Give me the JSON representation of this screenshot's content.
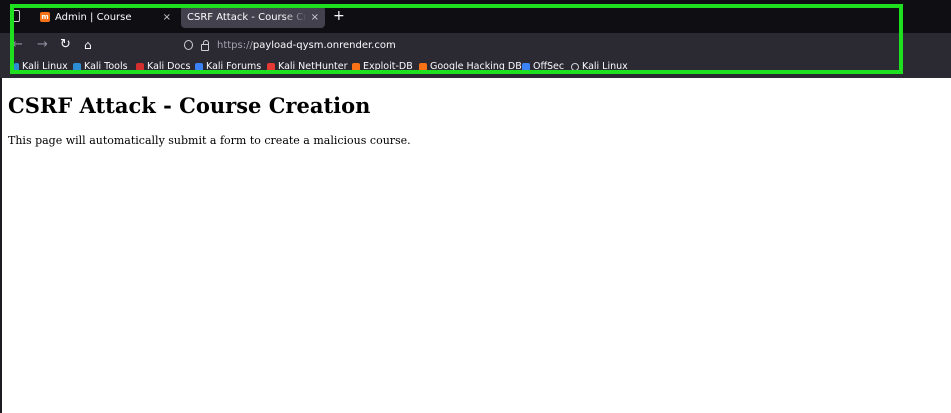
{
  "browser": {
    "tabs": [
      {
        "label": "Admin | Course",
        "active": false
      },
      {
        "label": "CSRF Attack - Course Creation",
        "active": true
      }
    ],
    "new_tab": "+",
    "close_glyph": "×",
    "url_protocol": "https://",
    "url_host": "payload-qysm.onrender.com",
    "bookmarks": [
      {
        "label": "Kali Linux",
        "icon": "kali-icon",
        "color": "#2c8fd6"
      },
      {
        "label": "Kali Tools",
        "icon": "kali-tools-icon",
        "color": "#2c8fd6"
      },
      {
        "label": "Kali Docs",
        "icon": "kali-docs-icon",
        "color": "#d32f2f"
      },
      {
        "label": "Kali Forums",
        "icon": "kali-forums-icon",
        "color": "#3b82f6"
      },
      {
        "label": "Kali NetHunter",
        "icon": "nethunter-icon",
        "color": "#e53935"
      },
      {
        "label": "Exploit-DB",
        "icon": "exploit-db-icon",
        "color": "#f97316"
      },
      {
        "label": "Google Hacking DB",
        "icon": "ghdb-icon",
        "color": "#f97316"
      },
      {
        "label": "OffSec",
        "icon": "offsec-icon",
        "color": "#3b82f6"
      },
      {
        "label": "Kali Linux",
        "icon": "globe-icon",
        "color": "#cfcfd8"
      }
    ],
    "highlight_color": "#1ee01e"
  },
  "page": {
    "heading": "CSRF Attack - Course Creation",
    "description": "This page will automatically submit a form to create a malicious course."
  }
}
